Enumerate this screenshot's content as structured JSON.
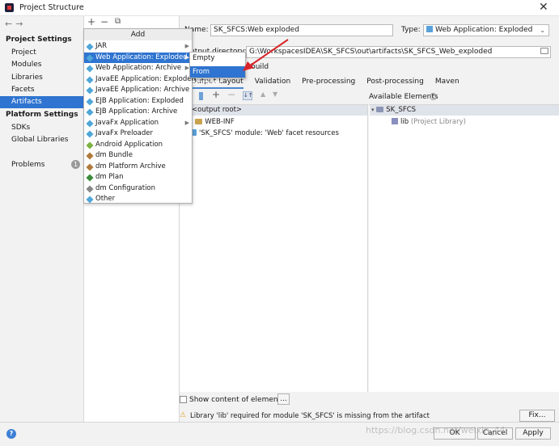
{
  "window": {
    "title": "Project Structure"
  },
  "sidebar": {
    "project_settings_header": "Project Settings",
    "project_settings": [
      "Project",
      "Modules",
      "Libraries",
      "Facets",
      "Artifacts"
    ],
    "selected": "Artifacts",
    "platform_settings_header": "Platform Settings",
    "platform_settings": [
      "SDKs",
      "Global Libraries"
    ],
    "problems_label": "Problems",
    "problems_count": "1"
  },
  "artifacts_toolbar": {
    "add": "+",
    "remove": "−",
    "copy": "⧉"
  },
  "add_menu": {
    "header": "Add",
    "items": [
      {
        "label": "JAR",
        "submenu": true
      },
      {
        "label": "Web Application: Exploded",
        "submenu": true,
        "selected": true
      },
      {
        "label": "Web Application: Archive",
        "submenu": true
      },
      {
        "label": "JavaEE Application: Exploded",
        "submenu": false
      },
      {
        "label": "JavaEE Application: Archive",
        "submenu": false
      },
      {
        "label": "EJB Application: Exploded",
        "submenu": false
      },
      {
        "label": "EJB Application: Archive",
        "submenu": false
      },
      {
        "label": "JavaFx Application",
        "submenu": true
      },
      {
        "label": "JavaFx Preloader",
        "submenu": false
      },
      {
        "label": "Android Application",
        "submenu": false
      },
      {
        "label": "dm Bundle",
        "submenu": false
      },
      {
        "label": "dm Platform Archive",
        "submenu": false
      },
      {
        "label": "dm Plan",
        "submenu": false
      },
      {
        "label": "dm Configuration",
        "submenu": false
      },
      {
        "label": "Other",
        "submenu": false
      }
    ]
  },
  "submenu": {
    "items": [
      "Empty",
      "From Modules..."
    ],
    "selected": "From Modules..."
  },
  "form": {
    "name_label": "Name:",
    "name_value": "SK_SFCS:Web exploded",
    "type_label": "Type:",
    "type_value": "Web Application: Exploded",
    "output_dir_label": "Output directory:",
    "output_dir_value": "G:\\WorkspacesIDEA\\SK_SFCS\\out\\artifacts\\SK_SFCS_Web_exploded",
    "include_build_label": "build"
  },
  "tabs": [
    "Output Layout",
    "Validation",
    "Pre-processing",
    "Post-processing",
    "Maven"
  ],
  "layout_tree": [
    "<output root>",
    "WEB-INF",
    "'SK_SFCS' module: 'Web' facet resources"
  ],
  "available_elements_label": "Available Elements",
  "available_tree": {
    "root": "SK_SFCS",
    "child": "lib",
    "child_note": "(Project Library)"
  },
  "show_content_label": "Show content of elements",
  "more_button": "...",
  "warning_text": "Library 'lib' required for module 'SK_SFCS' is missing from the artifact",
  "fix_button": "Fix...",
  "ok_button": "OK",
  "cancel_button": "Cancel",
  "apply_button": "Apply",
  "watermark": "https://blog.csdn.net/weixin_44"
}
